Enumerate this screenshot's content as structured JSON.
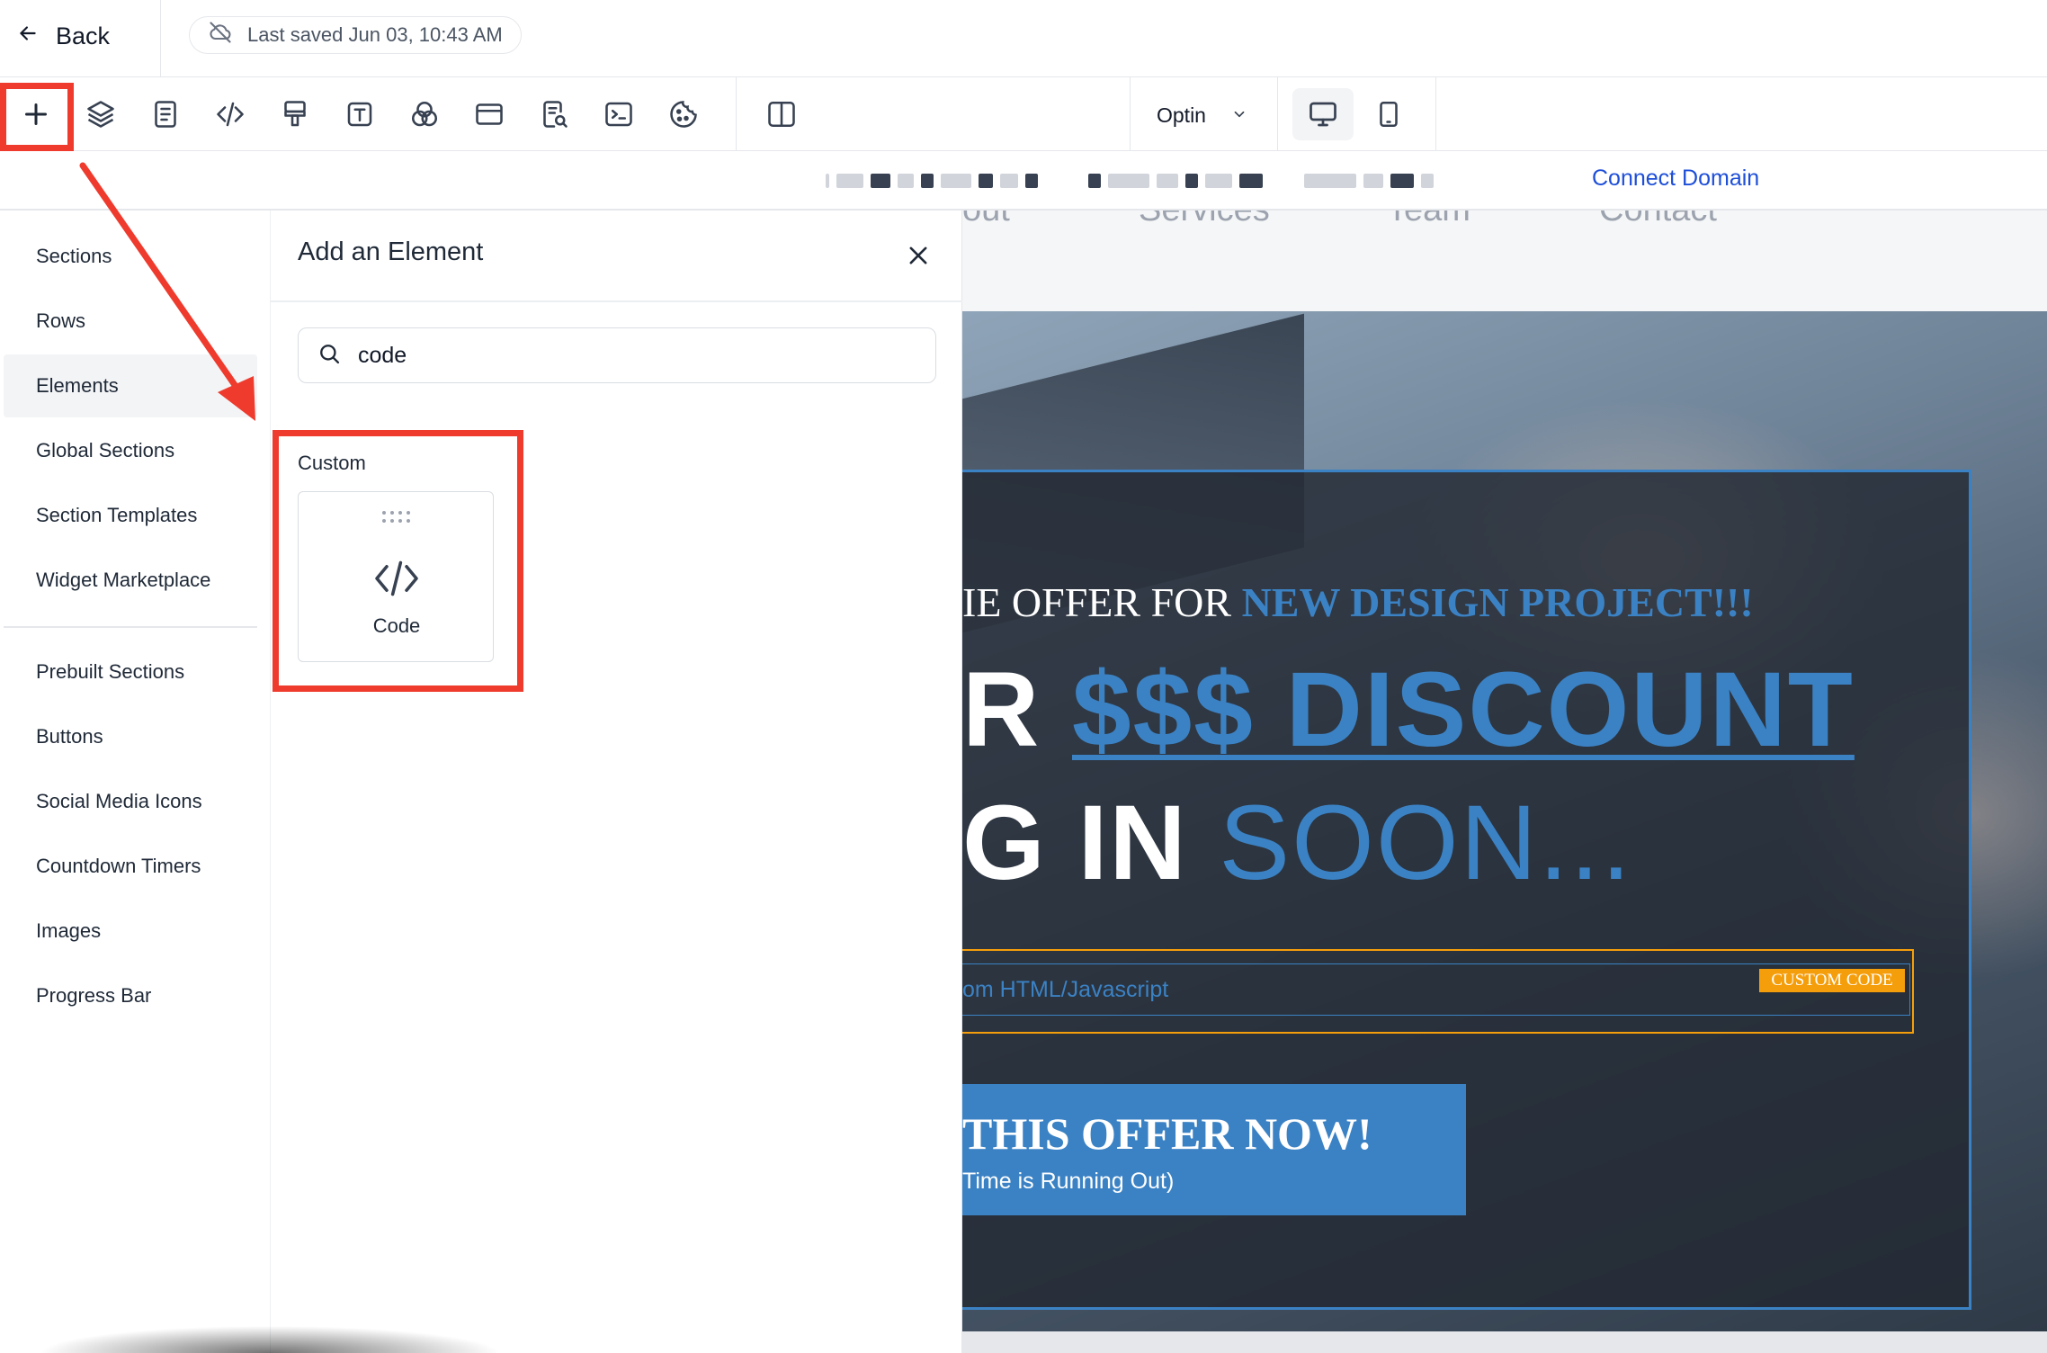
{
  "header": {
    "back_label": "Back",
    "saved_text": "Last saved Jun 03, 10:43 AM"
  },
  "toolbar": {
    "tools": [
      "add-icon",
      "layers-icon",
      "page-icon",
      "code-icon",
      "paint-brush-icon",
      "text-icon",
      "color-icon",
      "browser-window-icon",
      "search-document-icon",
      "terminal-icon",
      "cookie-icon",
      "split-view-icon"
    ],
    "mode_label": "Optin",
    "devices": [
      "desktop-icon",
      "mobile-icon"
    ]
  },
  "url_bar": {
    "connect_label": "Connect Domain"
  },
  "left_nav": {
    "items": [
      {
        "label": "Sections"
      },
      {
        "label": "Rows"
      },
      {
        "label": "Elements",
        "active": true
      },
      {
        "label": "Global Sections"
      },
      {
        "label": "Section Templates"
      },
      {
        "label": "Widget Marketplace"
      },
      {
        "label": "Prebuilt Sections"
      },
      {
        "label": "Buttons"
      },
      {
        "label": "Social Media Icons"
      },
      {
        "label": "Countdown Timers"
      },
      {
        "label": "Images"
      },
      {
        "label": "Progress Bar"
      }
    ]
  },
  "panel": {
    "title": "Add an Element",
    "search_value": "code",
    "group_label": "Custom",
    "card_label": "Code"
  },
  "canvas": {
    "nav_links": [
      "out",
      "Services",
      "Team",
      "Contact"
    ],
    "hero": {
      "line1_prefix": "IE OFFER FOR ",
      "line1_highlight": "NEW DESIGN PROJECT!!!",
      "line2_prefix": "R ",
      "line2_highlight": "$$$ DISCOUNT",
      "line3_prefix": "G IN ",
      "line3_highlight": "SOON...",
      "custom_text": "om HTML/Javascript",
      "custom_tag": "CUSTOM CODE",
      "cta_title": "THIS OFFER NOW!",
      "cta_sub": "Time is Running Out)"
    }
  },
  "colors": {
    "accent_blue": "#3b82c4",
    "link_blue": "#1d4ed8",
    "annotation_red": "#ef3b2d",
    "custom_code_orange": "#f59e0b"
  }
}
